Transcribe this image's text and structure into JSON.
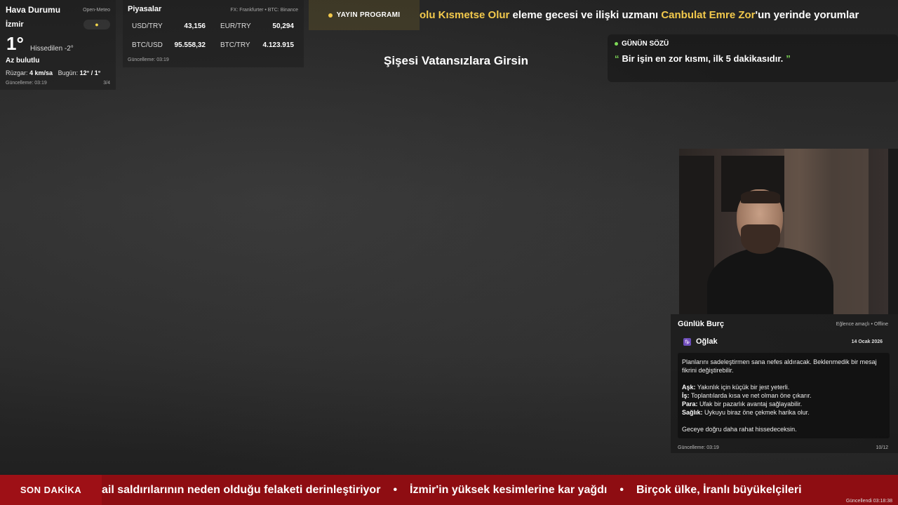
{
  "weather": {
    "title": "Hava Durumu",
    "source": "Open-Meteo",
    "city": "İzmir",
    "icon": "sun-icon",
    "temp": "1°",
    "feels_like": "Hissedilen -2°",
    "description": "Az bulutlu",
    "wind_label": "Rüzgar:",
    "wind_value": "4 km/sa",
    "today_label": "Bugün:",
    "today_value": "12° / 1°",
    "updated": "Güncelleme: 03:19",
    "page": "3/4"
  },
  "markets": {
    "title": "Piyasalar",
    "source": "FX: Frankfurter • BTC: Binance",
    "rows": [
      {
        "label": "USD/TRY",
        "value": "43,156"
      },
      {
        "label": "EUR/TRY",
        "value": "50,294"
      },
      {
        "label": "BTC/USD",
        "value": "95.558,32"
      },
      {
        "label": "BTC/TRY",
        "value": "4.123.915"
      }
    ],
    "updated": "Güncelleme: 03:19"
  },
  "schedule": {
    "label": "YAYIN PROGRAMI"
  },
  "top_ticker": {
    "part1": "olu Kısmetse Olur",
    "part2": " eleme gecesi ve ilişki uzmanı ",
    "part3": "Canbulat Emre Zor",
    "part4": "'un yerinde yorumlar"
  },
  "now_title": "Şişesi Vatansızlara Girsin",
  "quote": {
    "title": "GÜNÜN SÖZÜ",
    "open_mark": "“",
    "text": "Bir işin en zor kısmı, ilk 5 dakikasıdır.",
    "close_mark": "”"
  },
  "horoscope": {
    "title": "Günlük Burç",
    "tag": "Eğlence amaçlı • Offline",
    "sign_icon": "♑",
    "sign": "Oğlak",
    "date": "14 Ocak 2026",
    "intro": "Planlarını sadeleştirmen sana nefes aldıracak. Beklenmedik bir mesaj fikrini değiştirebilir.",
    "love_label": "Aşk:",
    "love": "Yakınlık için küçük bir jest yeterli.",
    "work_label": "İş:",
    "work": "Toplantılarda kısa ve net olman öne çıkarır.",
    "money_label": "Para:",
    "money": "Ufak bir pazarlık avantaj sağlayabilir.",
    "health_label": "Sağlık:",
    "health": "Uykuyu biraz öne çekmek harika olur.",
    "outro": "Geceye doğru daha rahat hissedeceksin.",
    "updated": "Güncelleme: 03:19",
    "page": "10/12"
  },
  "breaking": {
    "label": "SON DAKİKA",
    "items": [
      "ail saldırılarının neden olduğu felaketi derinleştiriyor",
      "İzmir'in yüksek kesimlerine kar yağdı",
      "Birçok ülke, İranlı büyükelçileri"
    ],
    "separator": "•",
    "updated": "Güncellendi 03:18:38"
  }
}
